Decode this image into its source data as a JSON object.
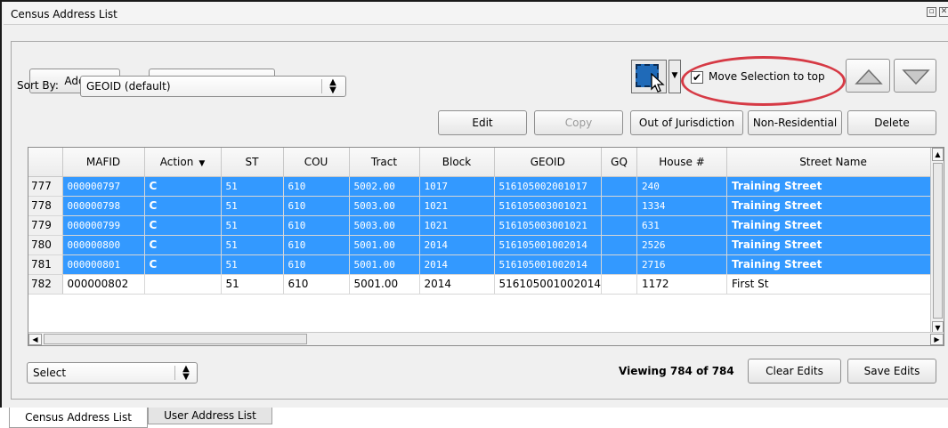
{
  "window": {
    "title": "Census Address List"
  },
  "toolbar": {
    "add_label": "Add",
    "deselect_label": "Deselect All Features",
    "move_selection_label": "Move Selection to top",
    "move_selection_checked": true
  },
  "sort": {
    "label": "Sort By:",
    "value": "GEOID (default)"
  },
  "actions": {
    "edit": "Edit",
    "copy": "Copy",
    "out_of_jurisdiction": "Out of Jurisdiction",
    "non_residential": "Non-Residential",
    "delete": "Delete"
  },
  "table": {
    "headers": [
      "MAFID",
      "Action",
      "ST",
      "COU",
      "Tract",
      "Block",
      "GEOID",
      "GQ",
      "House #",
      "Street Name"
    ],
    "rows": [
      {
        "num": "777",
        "selected": true,
        "cells": [
          "000000797",
          "C",
          "51",
          "610",
          "5002.00",
          "1017",
          "516105002001017",
          "",
          "240",
          "Training Street"
        ]
      },
      {
        "num": "778",
        "selected": true,
        "cells": [
          "000000798",
          "C",
          "51",
          "610",
          "5003.00",
          "1021",
          "516105003001021",
          "",
          "1334",
          "Training Street"
        ]
      },
      {
        "num": "779",
        "selected": true,
        "cells": [
          "000000799",
          "C",
          "51",
          "610",
          "5003.00",
          "1021",
          "516105003001021",
          "",
          "631",
          "Training Street"
        ]
      },
      {
        "num": "780",
        "selected": true,
        "cells": [
          "000000800",
          "C",
          "51",
          "610",
          "5001.00",
          "2014",
          "516105001002014",
          "",
          "2526",
          "Training Street"
        ]
      },
      {
        "num": "781",
        "selected": true,
        "cells": [
          "000000801",
          "C",
          "51",
          "610",
          "5001.00",
          "2014",
          "516105001002014",
          "",
          "2716",
          "Training Street"
        ]
      },
      {
        "num": "782",
        "selected": false,
        "cells": [
          "000000802",
          "",
          "51",
          "610",
          "5001.00",
          "2014",
          "516105001002014",
          "",
          "1172",
          "First St"
        ]
      }
    ]
  },
  "footer": {
    "select_value": "Select",
    "viewing_text": "Viewing 784 of 784",
    "clear_edits": "Clear Edits",
    "save_edits": "Save Edits"
  },
  "tabs": [
    {
      "label": "Census Address List",
      "active": true
    },
    {
      "label": "User Address List",
      "active": false
    }
  ],
  "colors": {
    "selection": "#3399ff",
    "highlight_ring": "#d63a45"
  },
  "icons": [
    "restore-icon",
    "close-icon",
    "select-features-icon",
    "chevron-down-icon",
    "arrow-up-icon",
    "arrow-down-icon",
    "sort-desc-icon"
  ]
}
